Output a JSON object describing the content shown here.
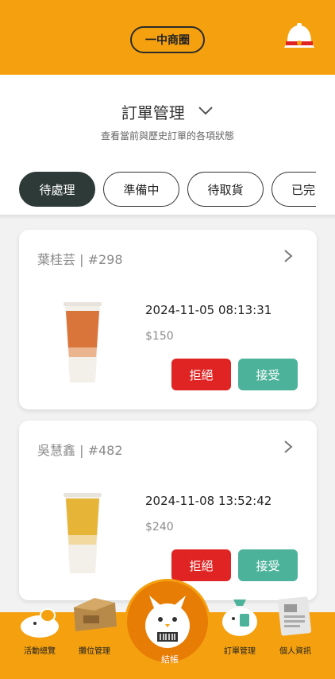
{
  "topbar": {
    "zone_label": "一中商圈",
    "bell_icon": "bell-icon",
    "accent": "#f5a10f"
  },
  "header": {
    "title": "訂單管理",
    "subtitle": "查看當前與歷史訂單的各項狀態"
  },
  "tabs": [
    {
      "label": "待處理",
      "active": true
    },
    {
      "label": "準備中",
      "active": false
    },
    {
      "label": "待取貨",
      "active": false
    },
    {
      "label": "已完",
      "active": false
    }
  ],
  "orders": [
    {
      "customer": "葉桂芸 | #298",
      "datetime": "2024-11-05 08:13:31",
      "price": "$150",
      "reject_label": "拒絕",
      "accept_label": "接受"
    },
    {
      "customer": "吳慧鑫 | #482",
      "datetime": "2024-11-08 13:52:42",
      "price": "$240",
      "reject_label": "拒絕",
      "accept_label": "接受"
    }
  ],
  "bottom_nav": [
    {
      "label": "活動總覽",
      "icon": "activity-icon"
    },
    {
      "label": "攤位管理",
      "icon": "booth-icon"
    },
    {
      "label": "結帳",
      "icon": "checkout-icon"
    },
    {
      "label": "訂單管理",
      "icon": "orders-icon"
    },
    {
      "label": "個人資訊",
      "icon": "profile-icon"
    }
  ],
  "colors": {
    "reject": "#e02424",
    "accept": "#4cb29a",
    "active_tab": "#2e3a37",
    "nav_center": "#e77d05"
  }
}
